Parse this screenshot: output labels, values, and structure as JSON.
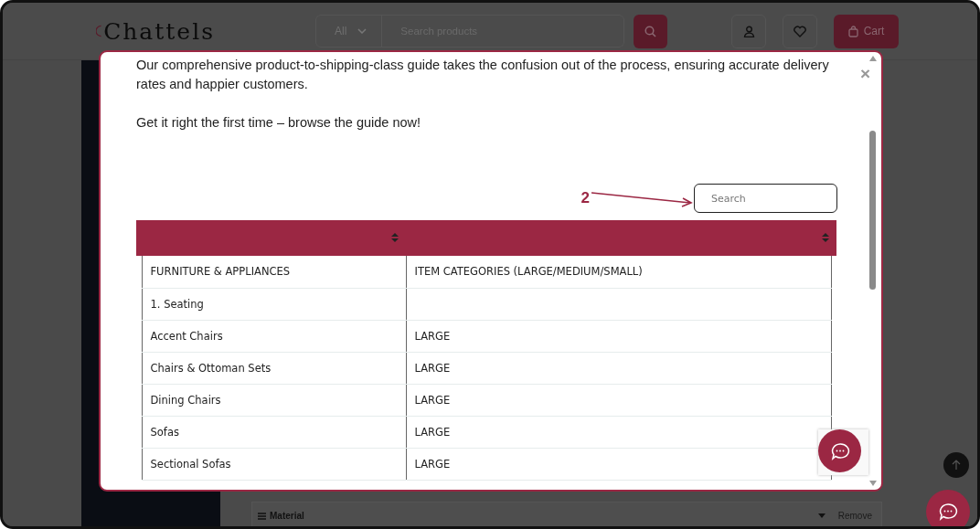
{
  "header": {
    "logo": "Chattels",
    "category": "All",
    "search": {
      "placeholder": "Search products"
    },
    "cart": "Cart"
  },
  "filter_bar": {
    "label": "Material",
    "action": "Remove"
  },
  "modal": {
    "paragraphs": [
      "Our comprehensive product-to-shipping-class guide takes the confusion out of the process, ensuring accurate delivery rates and happier customers.",
      "Get it right the first time – browse the guide now!"
    ],
    "annotation": "2",
    "search": {
      "placeholder": "Search"
    },
    "close": "×",
    "table": {
      "rows": [
        [
          "FURNITURE & APPLIANCES",
          "ITEM CATEGORIES (LARGE/MEDIUM/SMALL)"
        ],
        [
          "1. Seating",
          ""
        ],
        [
          "Accent Chairs",
          "LARGE"
        ],
        [
          "Chairs & Ottoman Sets",
          "LARGE"
        ],
        [
          "Dining Chairs",
          "LARGE"
        ],
        [
          "Sofas",
          "LARGE"
        ],
        [
          "Sectional Sofas",
          "LARGE"
        ]
      ]
    }
  }
}
